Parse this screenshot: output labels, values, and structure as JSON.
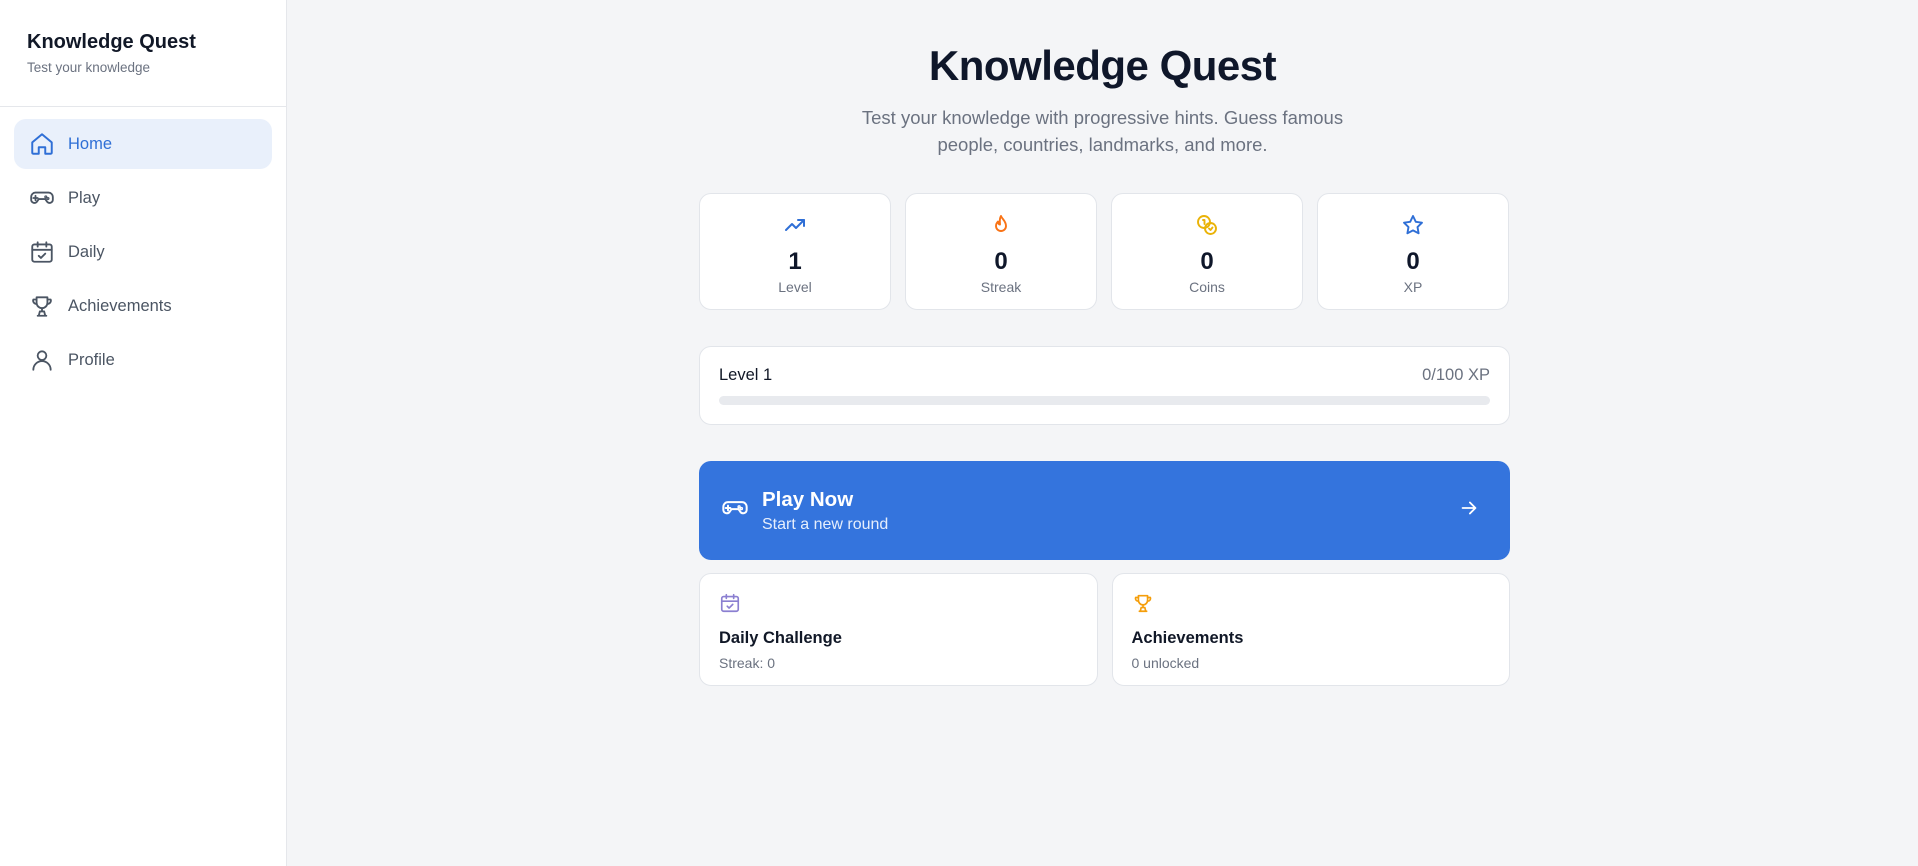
{
  "sidebar": {
    "title": "Knowledge Quest",
    "subtitle": "Test your knowledge",
    "items": [
      {
        "label": "Home",
        "icon": "home-icon",
        "active": true
      },
      {
        "label": "Play",
        "icon": "gamepad-icon"
      },
      {
        "label": "Daily",
        "icon": "calendar-check-icon"
      },
      {
        "label": "Achievements",
        "icon": "trophy-icon"
      },
      {
        "label": "Profile",
        "icon": "user-icon"
      }
    ]
  },
  "hero": {
    "title": "Knowledge Quest",
    "subtitle": "Test your knowledge with progressive hints. Guess famous people, countries, landmarks, and more."
  },
  "stats": [
    {
      "value": "1",
      "label": "Level",
      "icon": "trending-up-icon",
      "color": "#2f6fd6"
    },
    {
      "value": "0",
      "label": "Streak",
      "icon": "flame-icon",
      "color": "#f97316"
    },
    {
      "value": "0",
      "label": "Coins",
      "icon": "coins-icon",
      "color": "#eab308"
    },
    {
      "value": "0",
      "label": "XP",
      "icon": "star-icon",
      "color": "#2f6fd6"
    }
  ],
  "level": {
    "label": "Level 1",
    "xp_text": "0/100 XP",
    "progress": 0
  },
  "play": {
    "title": "Play Now",
    "subtitle": "Start a new round",
    "color": "#3474dd"
  },
  "tiles": {
    "daily": {
      "title": "Daily Challenge",
      "subtitle": "Streak: 0",
      "icon": "calendar-check-icon",
      "color": "#8b7fd1"
    },
    "achievements": {
      "title": "Achievements",
      "subtitle": "0 unlocked",
      "icon": "trophy-icon",
      "color": "#f59e0b"
    }
  }
}
